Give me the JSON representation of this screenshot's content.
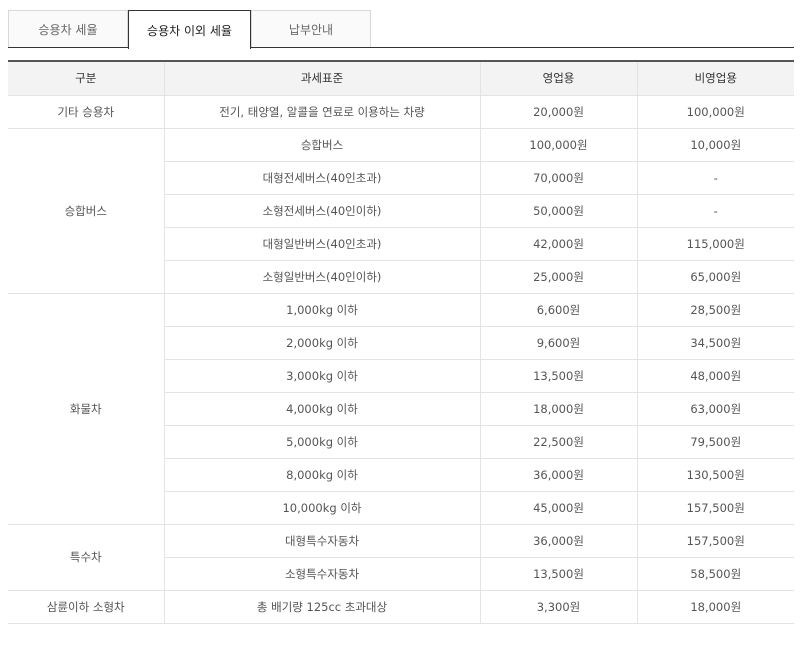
{
  "tabs": [
    {
      "label": "승용차 세율"
    },
    {
      "label": "승용차 이외 세율"
    },
    {
      "label": "납부안내"
    }
  ],
  "table": {
    "headers": [
      "구분",
      "과세표준",
      "영업용",
      "비영업용"
    ],
    "groups": [
      {
        "category": "기타 승용차",
        "rows": [
          {
            "standard": "전기, 태양열, 알콜을 연료로 이용하는 차량",
            "business": "20,000원",
            "non_business": "100,000원"
          }
        ]
      },
      {
        "category": "승합버스",
        "rows": [
          {
            "standard": "승합버스",
            "business": "100,000원",
            "non_business": "10,000원"
          },
          {
            "standard": "대형전세버스(40인초과)",
            "business": "70,000원",
            "non_business": "-"
          },
          {
            "standard": "소형전세버스(40인이하)",
            "business": "50,000원",
            "non_business": "-"
          },
          {
            "standard": "대형일반버스(40인초과)",
            "business": "42,000원",
            "non_business": "115,000원"
          },
          {
            "standard": "소형일반버스(40인이하)",
            "business": "25,000원",
            "non_business": "65,000원"
          }
        ]
      },
      {
        "category": "화물차",
        "rows": [
          {
            "standard": "1,000kg 이하",
            "business": "6,600원",
            "non_business": "28,500원"
          },
          {
            "standard": "2,000kg 이하",
            "business": "9,600원",
            "non_business": "34,500원"
          },
          {
            "standard": "3,000kg 이하",
            "business": "13,500원",
            "non_business": "48,000원"
          },
          {
            "standard": "4,000kg 이하",
            "business": "18,000원",
            "non_business": "63,000원"
          },
          {
            "standard": "5,000kg 이하",
            "business": "22,500원",
            "non_business": "79,500원"
          },
          {
            "standard": "8,000kg 이하",
            "business": "36,000원",
            "non_business": "130,500원"
          },
          {
            "standard": "10,000kg 이하",
            "business": "45,000원",
            "non_business": "157,500원"
          }
        ]
      },
      {
        "category": "특수차",
        "rows": [
          {
            "standard": "대형특수자동차",
            "business": "36,000원",
            "non_business": "157,500원"
          },
          {
            "standard": "소형특수자동차",
            "business": "13,500원",
            "non_business": "58,500원"
          }
        ]
      },
      {
        "category": "삼륜이하 소형차",
        "rows": [
          {
            "standard": "총 배기량 125cc 초과대상",
            "business": "3,300원",
            "non_business": "18,000원"
          }
        ]
      }
    ]
  }
}
